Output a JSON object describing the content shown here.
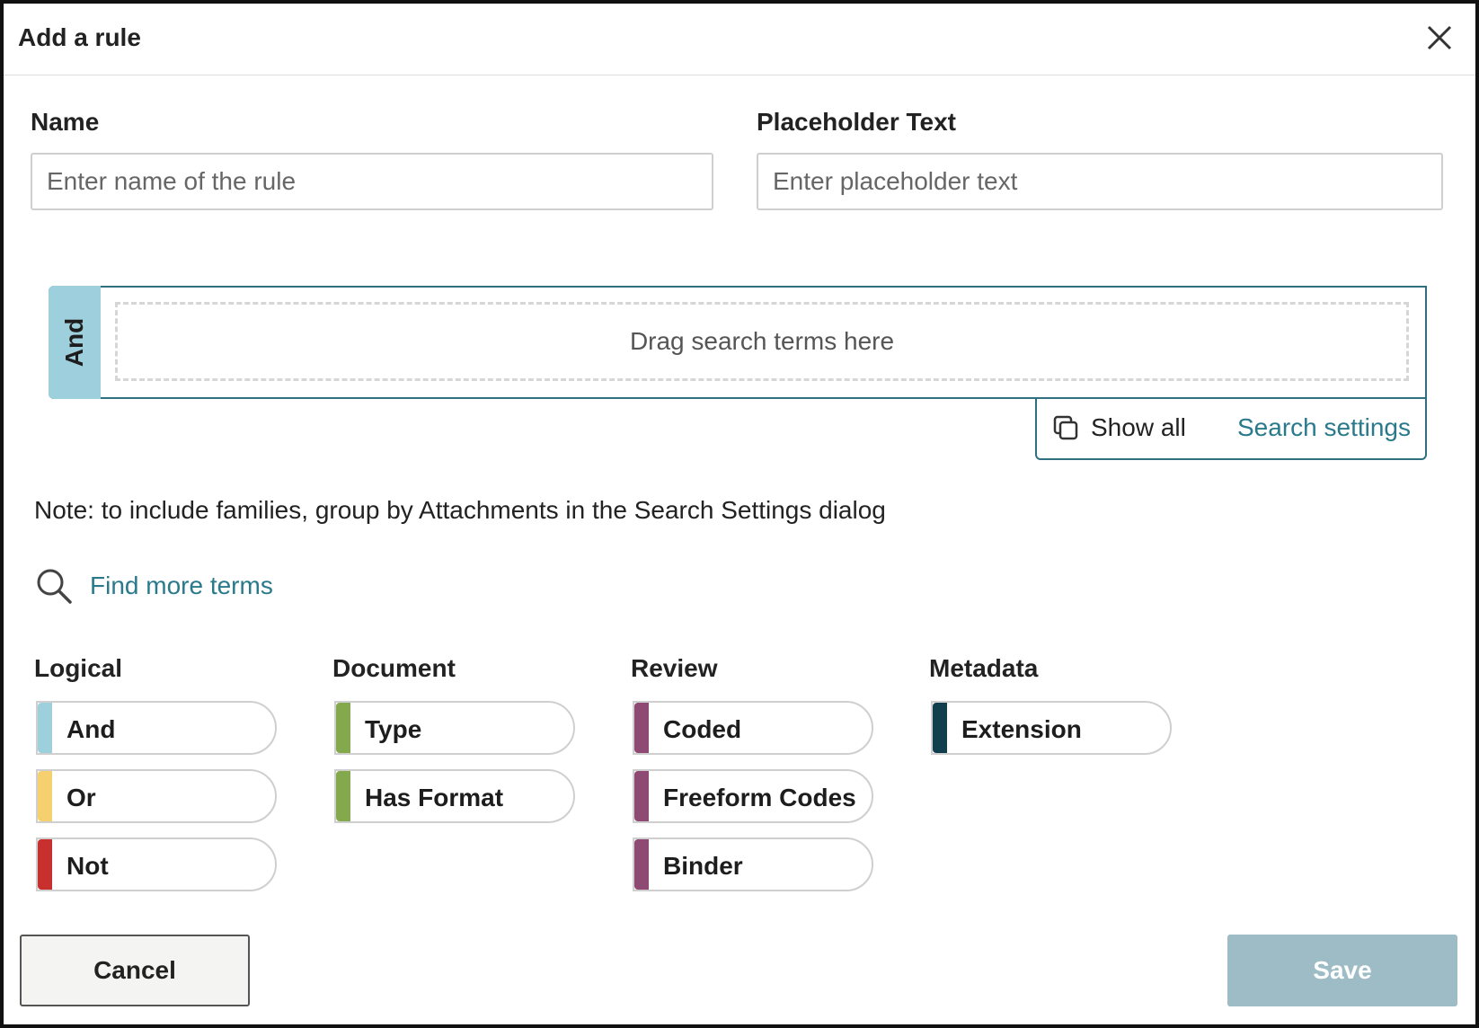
{
  "dialog": {
    "title": "Add a rule",
    "close_icon": "close-icon"
  },
  "form": {
    "name_label": "Name",
    "name_placeholder": "Enter name of the rule",
    "placeholder_label": "Placeholder Text",
    "placeholder_placeholder": "Enter placeholder text"
  },
  "builder": {
    "operator": "And",
    "drop_hint": "Drag search terms here",
    "show_all": "Show all",
    "show_all_icon": "copy-icon",
    "search_settings": "Search settings"
  },
  "note": "Note: to include families, group by Attachments in the Search Settings dialog",
  "find_more": {
    "label": "Find more terms",
    "icon": "search-icon"
  },
  "term_groups": [
    {
      "title": "Logical",
      "terms": [
        {
          "label": "And",
          "color": "#9ecfdc"
        },
        {
          "label": "Or",
          "color": "#f5d06e"
        },
        {
          "label": "Not",
          "color": "#c7302f"
        }
      ]
    },
    {
      "title": "Document",
      "terms": [
        {
          "label": "Type",
          "color": "#84a94c"
        },
        {
          "label": "Has Format",
          "color": "#84a94c"
        }
      ]
    },
    {
      "title": "Review",
      "terms": [
        {
          "label": "Coded",
          "color": "#8e4a73"
        },
        {
          "label": "Freeform Codes",
          "color": "#8e4a73"
        },
        {
          "label": "Binder",
          "color": "#8e4a73"
        }
      ]
    },
    {
      "title": "Metadata",
      "terms": [
        {
          "label": "Extension",
          "color": "#123f4d"
        }
      ]
    }
  ],
  "footer": {
    "cancel": "Cancel",
    "save": "Save"
  },
  "colors": {
    "accent_link": "#2a7a8c",
    "builder_border": "#2f6f80",
    "save_disabled": "#9dbcc6"
  }
}
